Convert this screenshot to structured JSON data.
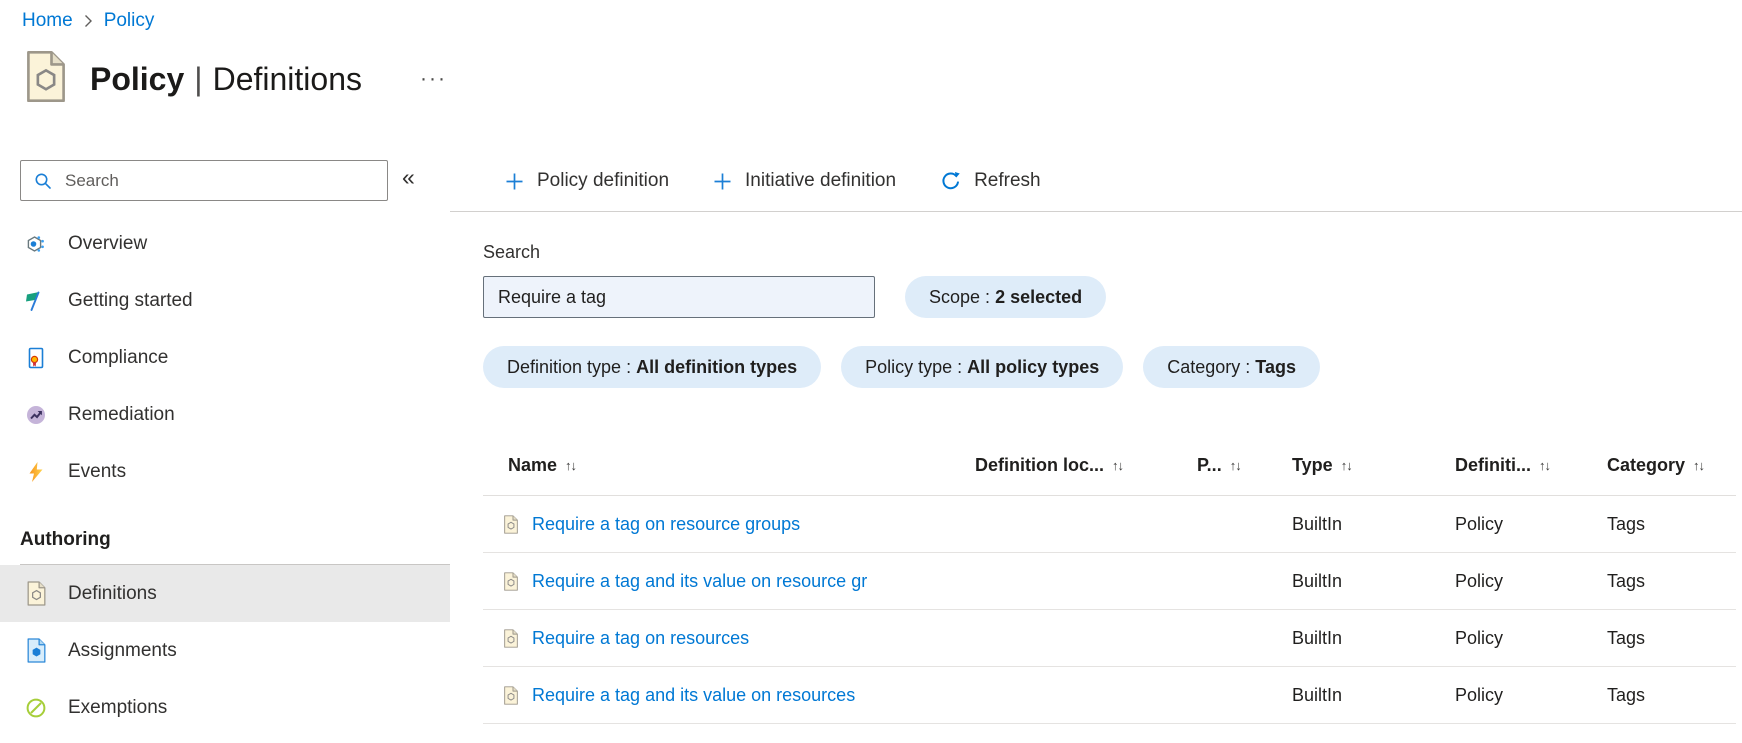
{
  "breadcrumb": {
    "items": [
      "Home",
      "Policy"
    ]
  },
  "page": {
    "title_bold": "Policy",
    "title_separator": "|",
    "title_rest": "Definitions",
    "more_label": "···"
  },
  "sidebar": {
    "search_placeholder": "Search",
    "collapse_glyph": "«",
    "items": [
      {
        "label": "Overview"
      },
      {
        "label": "Getting started"
      },
      {
        "label": "Compliance"
      },
      {
        "label": "Remediation"
      },
      {
        "label": "Events"
      }
    ],
    "section_label": "Authoring",
    "authoring_items": [
      {
        "label": "Definitions",
        "selected": true
      },
      {
        "label": "Assignments",
        "selected": false
      },
      {
        "label": "Exemptions",
        "selected": false
      }
    ]
  },
  "toolbar": {
    "policy_definition_label": "Policy definition",
    "initiative_definition_label": "Initiative definition",
    "refresh_label": "Refresh"
  },
  "filters": {
    "search_label": "Search",
    "search_value": "Require a tag",
    "pill_separator": " : ",
    "scope": {
      "label": "Scope",
      "value": "2 selected"
    },
    "pills": [
      {
        "label": "Definition type",
        "value": "All definition types"
      },
      {
        "label": "Policy type",
        "value": "All policy types"
      },
      {
        "label": "Category",
        "value": "Tags"
      }
    ]
  },
  "table": {
    "sort_glyph": "↑↓",
    "columns": [
      {
        "label": "Name"
      },
      {
        "label": "Definition loc..."
      },
      {
        "label": "P..."
      },
      {
        "label": "Type"
      },
      {
        "label": "Definiti..."
      },
      {
        "label": "Category"
      }
    ],
    "rows": [
      {
        "name": "Require a tag on resource groups",
        "definition_location": "",
        "policies": "",
        "type": "BuiltIn",
        "definition_type": "Policy",
        "category": "Tags"
      },
      {
        "name": "Require a tag and its value on resource gr",
        "definition_location": "",
        "policies": "",
        "type": "BuiltIn",
        "definition_type": "Policy",
        "category": "Tags"
      },
      {
        "name": "Require a tag on resources",
        "definition_location": "",
        "policies": "",
        "type": "BuiltIn",
        "definition_type": "Policy",
        "category": "Tags"
      },
      {
        "name": "Require a tag and its value on resources",
        "definition_location": "",
        "policies": "",
        "type": "BuiltIn",
        "definition_type": "Policy",
        "category": "Tags"
      }
    ]
  },
  "colors": {
    "accent": "#0078d4",
    "link": "#0078d4",
    "pill_background": "#deecf9",
    "selected_item_background": "#e9e9e9"
  }
}
